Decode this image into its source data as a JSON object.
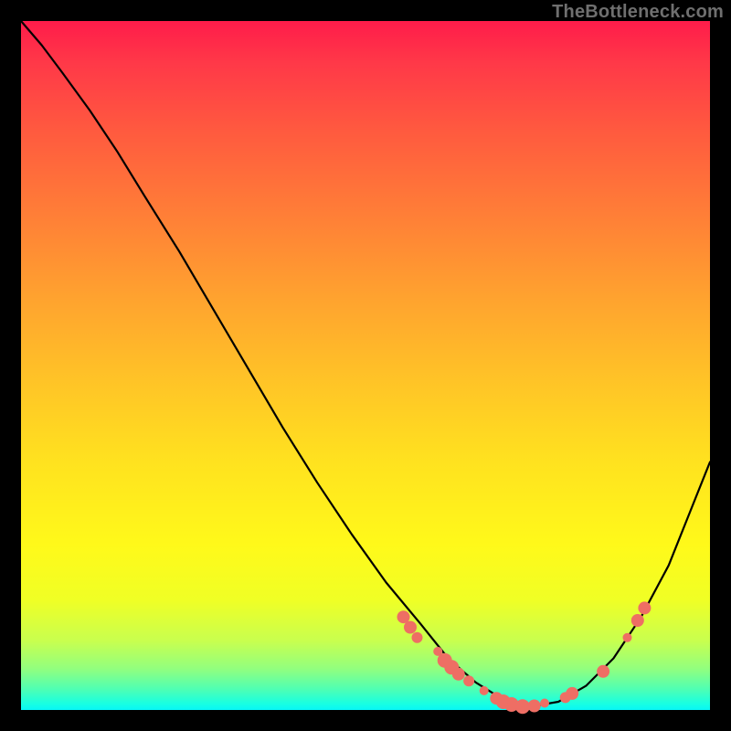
{
  "watermark": "TheBottleneck.com",
  "colors": {
    "dot": "#ee6e64",
    "curve": "#000000"
  },
  "chart_data": {
    "type": "line",
    "title": "",
    "xlabel": "",
    "ylabel": "",
    "xlim": [
      0,
      1
    ],
    "ylim": [
      0,
      1
    ],
    "grid": false,
    "legend": false,
    "series": [
      {
        "name": "curve",
        "x": [
          0.0,
          0.03,
          0.06,
          0.1,
          0.14,
          0.18,
          0.23,
          0.28,
          0.33,
          0.38,
          0.43,
          0.48,
          0.53,
          0.58,
          0.62,
          0.66,
          0.7,
          0.74,
          0.78,
          0.82,
          0.86,
          0.9,
          0.94,
          0.97,
          1.0
        ],
        "y": [
          1.0,
          0.965,
          0.925,
          0.87,
          0.81,
          0.745,
          0.665,
          0.58,
          0.495,
          0.41,
          0.33,
          0.255,
          0.185,
          0.125,
          0.075,
          0.04,
          0.015,
          0.005,
          0.012,
          0.035,
          0.075,
          0.135,
          0.21,
          0.285,
          0.36
        ]
      }
    ],
    "markers": [
      {
        "x": 0.555,
        "y": 0.135,
        "r": 7
      },
      {
        "x": 0.565,
        "y": 0.12,
        "r": 7
      },
      {
        "x": 0.575,
        "y": 0.105,
        "r": 6
      },
      {
        "x": 0.605,
        "y": 0.085,
        "r": 5
      },
      {
        "x": 0.615,
        "y": 0.072,
        "r": 8
      },
      {
        "x": 0.625,
        "y": 0.062,
        "r": 8
      },
      {
        "x": 0.635,
        "y": 0.052,
        "r": 7
      },
      {
        "x": 0.65,
        "y": 0.042,
        "r": 6
      },
      {
        "x": 0.672,
        "y": 0.028,
        "r": 5
      },
      {
        "x": 0.69,
        "y": 0.017,
        "r": 7
      },
      {
        "x": 0.7,
        "y": 0.012,
        "r": 8
      },
      {
        "x": 0.712,
        "y": 0.008,
        "r": 8
      },
      {
        "x": 0.728,
        "y": 0.005,
        "r": 8
      },
      {
        "x": 0.745,
        "y": 0.006,
        "r": 7
      },
      {
        "x": 0.76,
        "y": 0.01,
        "r": 5
      },
      {
        "x": 0.79,
        "y": 0.018,
        "r": 6
      },
      {
        "x": 0.8,
        "y": 0.024,
        "r": 7
      },
      {
        "x": 0.845,
        "y": 0.056,
        "r": 7
      },
      {
        "x": 0.88,
        "y": 0.105,
        "r": 5
      },
      {
        "x": 0.895,
        "y": 0.13,
        "r": 7
      },
      {
        "x": 0.905,
        "y": 0.148,
        "r": 7
      }
    ]
  }
}
